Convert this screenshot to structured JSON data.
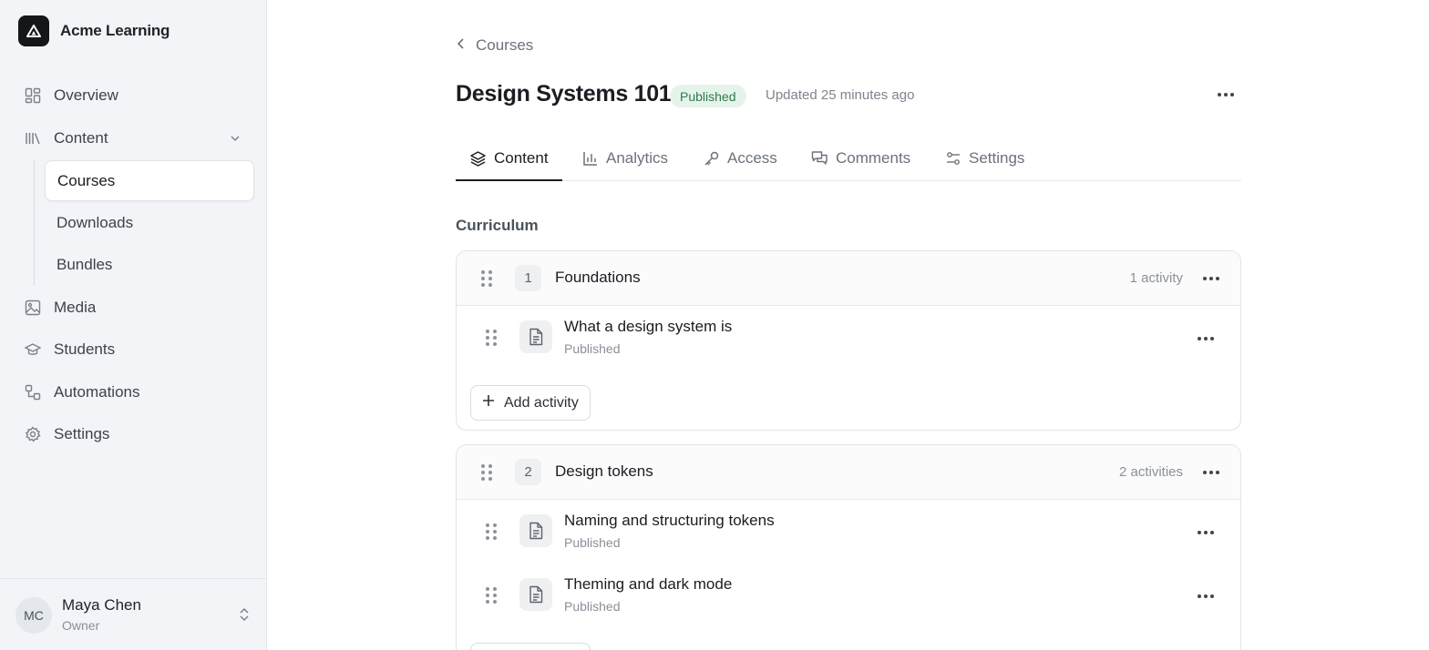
{
  "app": {
    "name": "Acme Learning",
    "logo_icon": "triangle-logo-icon"
  },
  "sidebar": {
    "items": [
      {
        "label": "Overview",
        "icon": "grid-icon"
      },
      {
        "label": "Content",
        "icon": "library-icon",
        "expanded": true
      },
      {
        "label": "Media",
        "icon": "image-icon"
      },
      {
        "label": "Students",
        "icon": "graduation-cap-icon"
      },
      {
        "label": "Automations",
        "icon": "workflow-icon"
      },
      {
        "label": "Settings",
        "icon": "gear-icon"
      }
    ],
    "content_subitems": [
      {
        "label": "Courses",
        "active": true
      },
      {
        "label": "Downloads",
        "active": false
      },
      {
        "label": "Bundles",
        "active": false
      }
    ]
  },
  "user": {
    "initials": "MC",
    "name": "Maya Chen",
    "role": "Owner"
  },
  "breadcrumb": {
    "label": "Courses"
  },
  "course": {
    "title": "Design Systems 101",
    "status": "Published",
    "updated": "Updated 25 minutes ago"
  },
  "tabs": [
    {
      "label": "Content",
      "icon": "layers-icon",
      "active": true
    },
    {
      "label": "Analytics",
      "icon": "bar-chart-icon",
      "active": false
    },
    {
      "label": "Access",
      "icon": "key-icon",
      "active": false
    },
    {
      "label": "Comments",
      "icon": "comments-icon",
      "active": false
    },
    {
      "label": "Settings",
      "icon": "sliders-icon",
      "active": false
    }
  ],
  "curriculum": {
    "label": "Curriculum",
    "add_activity_label": "Add activity",
    "modules": [
      {
        "number": "1",
        "title": "Foundations",
        "count": "1 activity",
        "activities": [
          {
            "title": "What a design system is",
            "status": "Published"
          }
        ]
      },
      {
        "number": "2",
        "title": "Design tokens",
        "count": "2 activities",
        "activities": [
          {
            "title": "Naming and structuring tokens",
            "status": "Published"
          },
          {
            "title": "Theming and dark mode",
            "status": "Published"
          }
        ]
      }
    ]
  },
  "colors": {
    "sidebar_bg": "#f2f4f7",
    "badge_bg": "#e5f4ea",
    "badge_text": "#2f7a4a",
    "text_primary": "#1a1d21"
  }
}
